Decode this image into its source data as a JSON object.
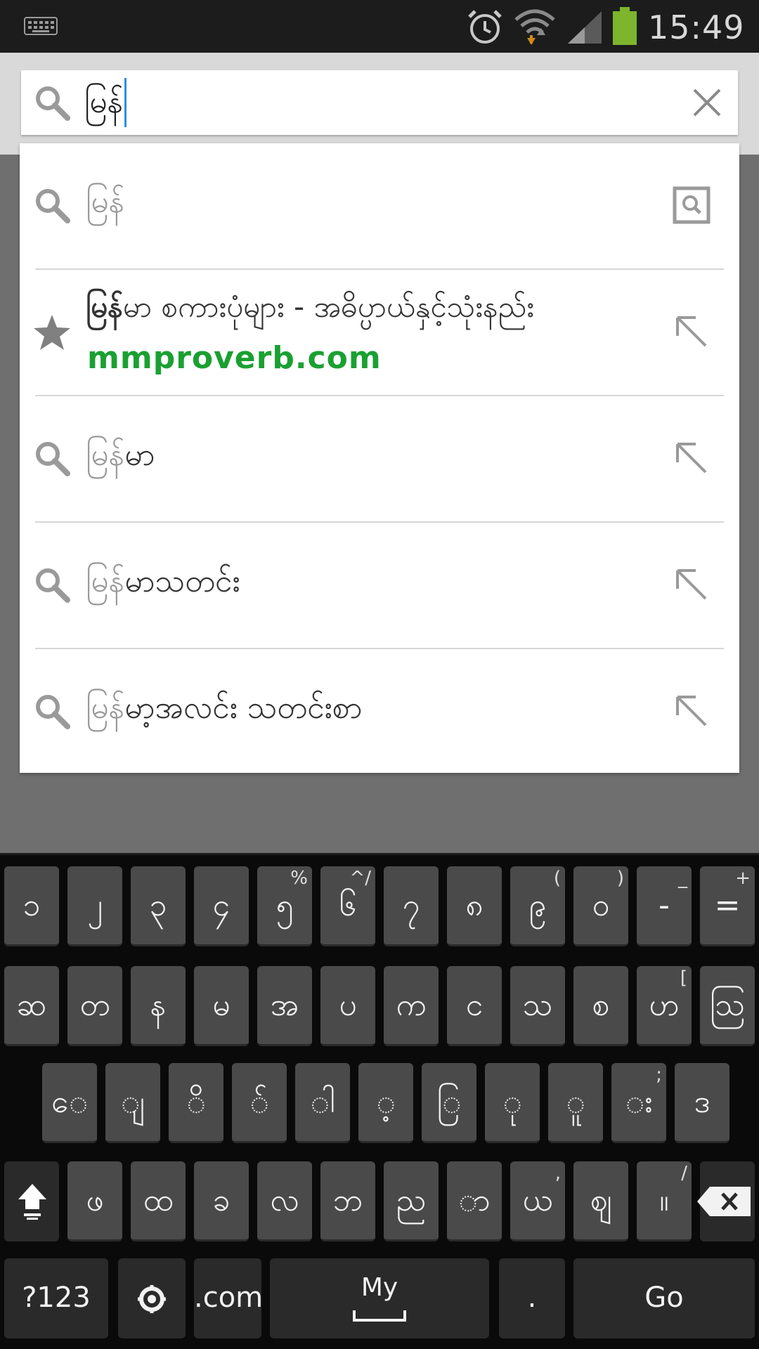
{
  "status_bar": {
    "time": "15:49",
    "icons": [
      "keyboard-icon",
      "alarm-icon",
      "wifi-icon",
      "signal-icon",
      "battery-icon"
    ],
    "battery_color": "#7db52d"
  },
  "omnibox": {
    "value": "မြန်",
    "search_icon": "search-icon",
    "clear_icon": "close-icon"
  },
  "suggestions": [
    {
      "type": "search",
      "typed": "မြန်",
      "rest": "",
      "action_icon": "search-box-icon"
    },
    {
      "type": "bookmark",
      "title_bold": "မြန်",
      "title_rest": "မာ စကားပုံများ - အဓိပ္ပာယ်နှင့်သုံးနည်း",
      "url": "mmproverb.com",
      "action_icon": "arrow-up-left-icon"
    },
    {
      "type": "search",
      "typed": "မြန်",
      "rest": "မာ",
      "action_icon": "arrow-up-left-icon"
    },
    {
      "type": "search",
      "typed": "မြန်",
      "rest": "မာသတင်း",
      "action_icon": "arrow-up-left-icon"
    },
    {
      "type": "search",
      "typed": "မြန်",
      "rest": "မာ့အလင်း သတင်းစာ",
      "action_icon": "arrow-up-left-icon"
    }
  ],
  "accent_url_color": "#1aa032",
  "keyboard": {
    "row1": [
      {
        "main": "၁",
        "hint": ""
      },
      {
        "main": "၂",
        "hint": ""
      },
      {
        "main": "၃",
        "hint": ""
      },
      {
        "main": "၄",
        "hint": ""
      },
      {
        "main": "၅",
        "hint": "%"
      },
      {
        "main": "၆",
        "hint": "^/"
      },
      {
        "main": "၇",
        "hint": ""
      },
      {
        "main": "၈",
        "hint": ""
      },
      {
        "main": "၉",
        "hint": "("
      },
      {
        "main": "၀",
        "hint": ")"
      },
      {
        "main": "-",
        "hint": "_"
      },
      {
        "main": "=",
        "hint": "+"
      }
    ],
    "row2": [
      {
        "main": "ဆ",
        "hint": ""
      },
      {
        "main": "တ",
        "hint": ""
      },
      {
        "main": "န",
        "hint": ""
      },
      {
        "main": "မ",
        "hint": ""
      },
      {
        "main": "အ",
        "hint": ""
      },
      {
        "main": "ပ",
        "hint": ""
      },
      {
        "main": "က",
        "hint": ""
      },
      {
        "main": "င",
        "hint": ""
      },
      {
        "main": "သ",
        "hint": ""
      },
      {
        "main": "စ",
        "hint": ""
      },
      {
        "main": "ဟ",
        "hint": "["
      },
      {
        "main": "ဩ",
        "hint": ""
      }
    ],
    "row3": [
      {
        "main": "ေ",
        "hint": ""
      },
      {
        "main": "ျ",
        "hint": ""
      },
      {
        "main": "ိ",
        "hint": ""
      },
      {
        "main": "်",
        "hint": ""
      },
      {
        "main": "ါ",
        "hint": ""
      },
      {
        "main": "့",
        "hint": ""
      },
      {
        "main": "ြ",
        "hint": ""
      },
      {
        "main": "ု",
        "hint": ""
      },
      {
        "main": "ူ",
        "hint": ""
      },
      {
        "main": "း",
        "hint": ";"
      },
      {
        "main": "ဒ",
        "hint": ""
      }
    ],
    "row4": [
      {
        "main": "ဖ",
        "hint": ""
      },
      {
        "main": "ထ",
        "hint": ""
      },
      {
        "main": "ခ",
        "hint": ""
      },
      {
        "main": "လ",
        "hint": ""
      },
      {
        "main": "ဘ",
        "hint": ""
      },
      {
        "main": "ည",
        "hint": ""
      },
      {
        "main": "ာ",
        "hint": ""
      },
      {
        "main": "ယ",
        "hint": ","
      },
      {
        "main": "ဈ",
        "hint": ""
      },
      {
        "main": "။",
        "hint": "/"
      }
    ],
    "symbols_label": "?123",
    "dotcom_label": ".com",
    "space_label": "My",
    "period_label": ".",
    "go_label": "Go"
  }
}
